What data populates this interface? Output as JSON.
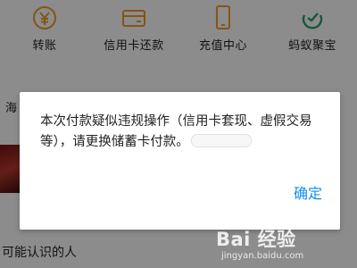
{
  "quick_actions": [
    {
      "label": "转账",
      "icon": "yen-icon"
    },
    {
      "label": "信用卡还款",
      "icon": "credit-card-icon"
    },
    {
      "label": "充值中心",
      "icon": "phone-icon"
    },
    {
      "label": "蚂蚁聚宝",
      "icon": "ant-fortune-icon"
    }
  ],
  "colors": {
    "accent": "#f39a2b",
    "link": "#108ee9",
    "overlay": "rgba(0,0,0,0.45)"
  },
  "background": {
    "partial_text_left": "海",
    "section_title": "可能认识的人"
  },
  "dialog": {
    "message": "本次付款疑似违规操作（信用卡套现、虚假交易等），请更换储蓄卡付款。",
    "confirm_label": "确定"
  },
  "watermark": {
    "brand": "Bai 经验",
    "url": "jingyan.baidu.com"
  }
}
